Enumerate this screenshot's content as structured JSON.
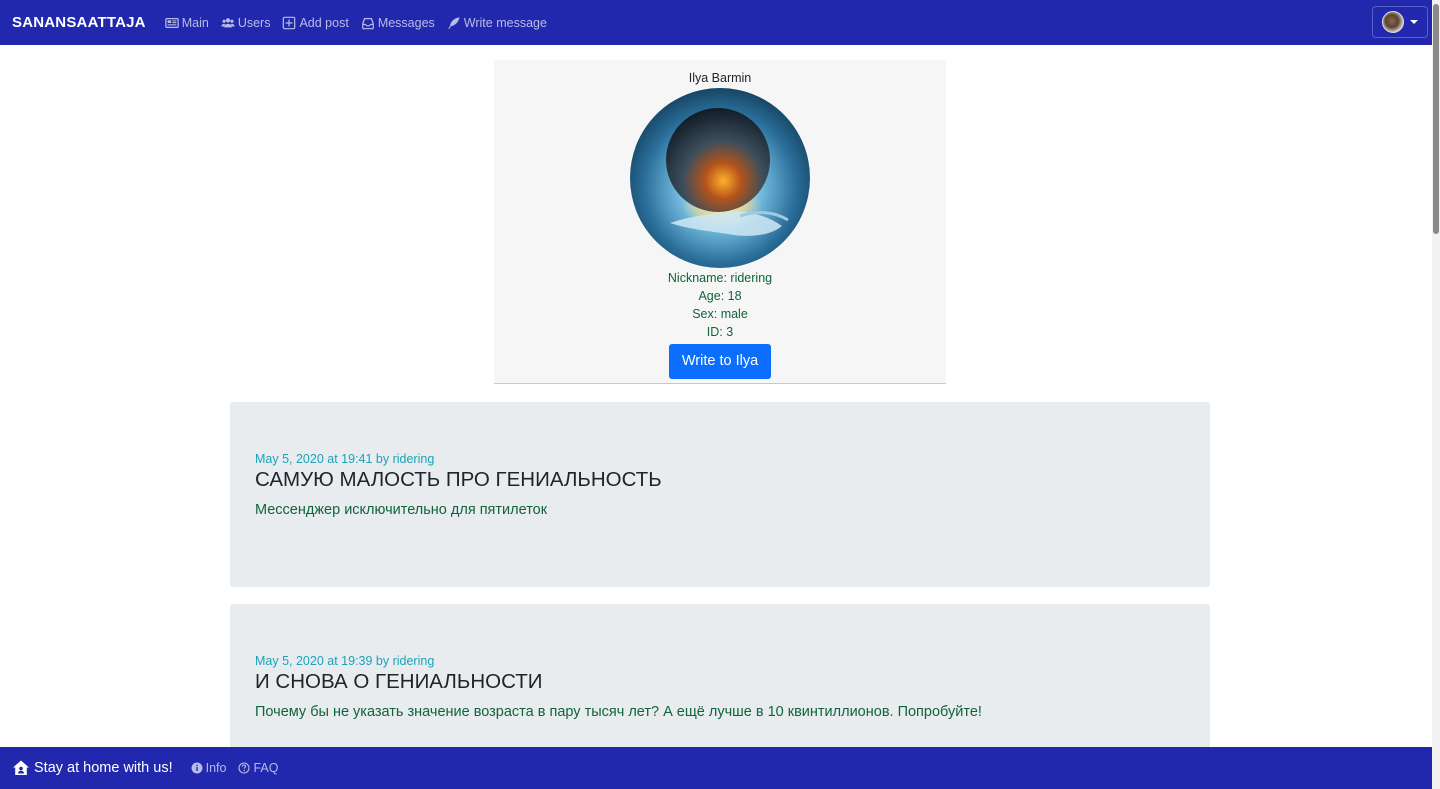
{
  "navbar": {
    "brand": "SANANSAATTAJA",
    "items": [
      {
        "label": "Main",
        "icon": "newspaper-icon"
      },
      {
        "label": "Users",
        "icon": "users-icon"
      },
      {
        "label": "Add post",
        "icon": "plus-square-icon"
      },
      {
        "label": "Messages",
        "icon": "inbox-icon"
      },
      {
        "label": "Write message",
        "icon": "feather-icon"
      }
    ],
    "user_menu_icon": "avatar"
  },
  "profile": {
    "name": "Ilya Barmin",
    "picture": "globe-in-hand-image",
    "nickname": "Nickname: ridering",
    "age": "Age: 18",
    "sex": "Sex: male",
    "id": "ID: 3",
    "button_label": "Write to Ilya"
  },
  "posts": [
    {
      "meta": "May 5, 2020 at 19:41 by ridering",
      "title": "САМУЮ МАЛОСТЬ ПРО ГЕНИАЛЬНОСТЬ",
      "body": "Мессенджер исключительно для пятилеток"
    },
    {
      "meta": "May 5, 2020 at 19:39 by ridering",
      "title": "И СНОВА О ГЕНИАЛЬНОСТИ",
      "body": "Почему бы не указать значение возраста в пару тысяч лет? А ещё лучше в 10 квинтиллионов. Попробуйте!"
    }
  ],
  "footer": {
    "brand": "Stay at home with us!",
    "brand_icon": "house-user-icon",
    "links": [
      {
        "label": "Info",
        "icon": "info-circle-icon"
      },
      {
        "label": "FAQ",
        "icon": "question-circle-icon"
      }
    ]
  },
  "colors": {
    "navbar": "#2128ad",
    "button": "#0d6efd",
    "meta": "#1ba2b8",
    "green_text": "#10643a",
    "post_bg": "#e9ecef"
  }
}
